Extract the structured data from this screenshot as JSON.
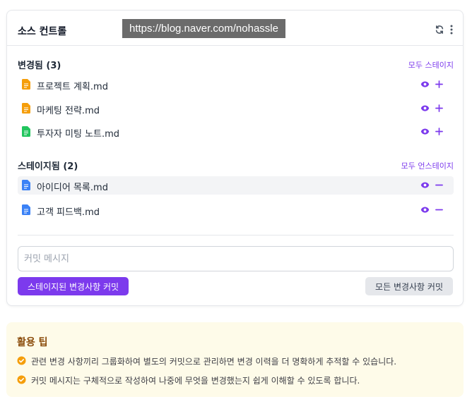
{
  "panel": {
    "title": "소스 컨트롤",
    "watermark": "https://blog.naver.com/nohassle",
    "icons": {
      "refresh": "refresh-icon",
      "more": "more-vertical-icon"
    }
  },
  "changed": {
    "title": "변경됨 (3)",
    "action": "모두 스테이지",
    "files": [
      {
        "name": "프로젝트 계획.md",
        "color": "#f59e0b"
      },
      {
        "name": "마케팅 전략.md",
        "color": "#f59e0b"
      },
      {
        "name": "투자자 미팅 노트.md",
        "color": "#22c55e"
      }
    ]
  },
  "staged": {
    "title": "스테이지됨 (2)",
    "action": "모두 언스테이지",
    "files": [
      {
        "name": "아이디어 목록.md",
        "color": "#3b82f6"
      },
      {
        "name": "고객 피드백.md",
        "color": "#3b82f6"
      }
    ]
  },
  "commit": {
    "placeholder": "커밋 메시지",
    "primary_label": "스테이지된 변경사항 커밋",
    "secondary_label": "모든 변경사항 커밋"
  },
  "tips": {
    "title": "활용 팁",
    "items": [
      "관련 변경 사항끼리 그룹화하여 별도의 커밋으로 관리하면 변경 이력을 더 명확하게 추적할 수 있습니다.",
      "커밋 메시지는 구체적으로 작성하여 나중에 무엇을 변경했는지 쉽게 이해할 수 있도록 합니다."
    ]
  },
  "colors": {
    "accent": "#7c3aed",
    "tip_icon": "#f59e0b",
    "tip_title": "#8a4b0a"
  }
}
